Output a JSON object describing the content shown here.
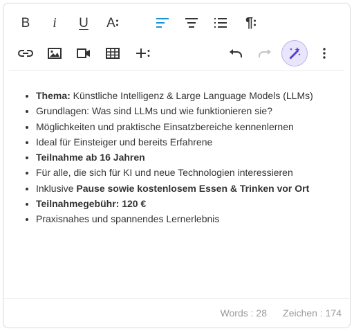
{
  "toolbar": {
    "row1": [
      {
        "name": "bold-button",
        "icon": "bold-icon",
        "label": "B"
      },
      {
        "name": "italic-button",
        "icon": "italic-icon",
        "label": "i"
      },
      {
        "name": "underline-button",
        "icon": "underline-icon",
        "label": "U"
      },
      {
        "name": "font-size-button",
        "icon": "font-size-icon"
      },
      {
        "name": "align-left-button",
        "icon": "align-left-icon",
        "active": true
      },
      {
        "name": "align-center-button",
        "icon": "align-center-icon"
      },
      {
        "name": "ordered-list-button",
        "icon": "ordered-list-icon"
      },
      {
        "name": "paragraph-button",
        "icon": "paragraph-icon"
      }
    ],
    "row2": [
      {
        "name": "insert-link-button",
        "icon": "link-icon"
      },
      {
        "name": "insert-image-button",
        "icon": "image-icon"
      },
      {
        "name": "insert-video-button",
        "icon": "video-icon"
      },
      {
        "name": "insert-table-button",
        "icon": "table-icon"
      },
      {
        "name": "insert-more-button",
        "icon": "plus-more-icon"
      },
      {
        "name": "undo-button",
        "icon": "undo-icon"
      },
      {
        "name": "redo-button",
        "icon": "redo-icon",
        "disabled": true
      },
      {
        "name": "ai-magic-button",
        "icon": "magic-wand-icon",
        "active": true
      },
      {
        "name": "more-options-button",
        "icon": "vertical-dots-icon"
      }
    ],
    "bold_label": "B",
    "italic_label": "i",
    "underline_label": "U",
    "font_size_label": "A",
    "paragraph_label": "¶"
  },
  "content": {
    "items": [
      {
        "bold": "Thema:",
        "text": " Künstliche Intelligenz & Large Language Models (LLMs)"
      },
      {
        "bold": "",
        "text": "Grundlagen: Was sind LLMs und wie funktionieren sie?"
      },
      {
        "bold": "",
        "text": "Möglichkeiten und praktische Einsatzbereiche kennenlernen"
      },
      {
        "bold": "",
        "text": "Ideal für Einsteiger und bereits Erfahrene"
      },
      {
        "bold": "Teilnahme ab 16 Jahren",
        "text": ""
      },
      {
        "bold": "",
        "text": "Für alle, die sich für KI und neue Technologien interessieren"
      },
      {
        "bold": "",
        "text": "Inklusive ",
        "bold_after": "Pause sowie kostenlosem Essen & Trinken vor Ort"
      },
      {
        "bold": "Teilnahmegebühr: 120 €",
        "text": ""
      },
      {
        "bold": "",
        "text": "Praxisnahes und spannendes Lernerlebnis"
      }
    ]
  },
  "footer": {
    "words": "Words : 28",
    "chars": "Zeichen : 174"
  },
  "colors": {
    "accent": "#1e90d6",
    "icon": "#333333",
    "disabled": "#c4c4c4",
    "magic": "#5b3fd6",
    "magic_bg": "#e9e6fb"
  }
}
